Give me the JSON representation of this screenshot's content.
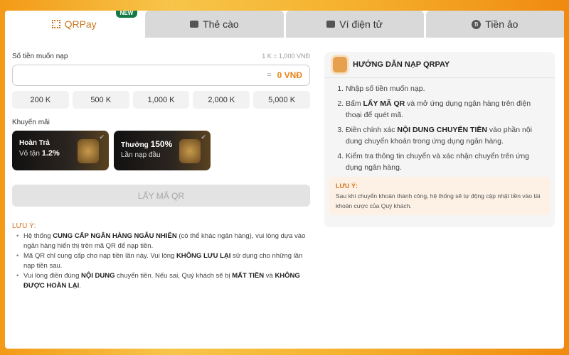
{
  "tabs": [
    {
      "label": "QRPay",
      "badge": "NEW"
    },
    {
      "label": "Thẻ cào"
    },
    {
      "label": "Ví điện tử"
    },
    {
      "label": "Tiền ảo"
    }
  ],
  "form": {
    "amount_label": "Số tiền muốn nạp",
    "rate": "1 K = 1,000 VNĐ",
    "equals": "=",
    "amount_value": "0 VNĐ",
    "chips": [
      "200 K",
      "500 K",
      "1,000 K",
      "2,000 K",
      "5,000 K"
    ]
  },
  "promos": {
    "label": "Khuyến mãi",
    "items": [
      {
        "title": "Hoàn Trả",
        "sub": "Vô tận",
        "highlight": "1.2%"
      },
      {
        "title": "Thưởng",
        "title_hl": "150%",
        "sub": "Lần nạp đầu"
      }
    ]
  },
  "get_qr": "LẤY MÃ QR",
  "notes": {
    "title": "LƯU Ý:",
    "items": [
      [
        "Hệ thống ",
        "CUNG CẤP NGÂN HÀNG NGẪU NHIÊN",
        " (có thể khác ngân hàng), vui lòng dựa vào ngân hàng hiển thị trên mã QR để nạp tiền."
      ],
      [
        "Mã QR chỉ cung cấp cho nạp tiền lần này. Vui lòng ",
        "KHÔNG LƯU LẠI",
        " sử dụng cho những lần nạp tiền sau."
      ],
      [
        "Vui lòng điền đúng ",
        "NỘI DUNG",
        " chuyển tiền. Nếu sai, Quý khách sẽ bị ",
        "MẤT TIỀN",
        " và ",
        "KHÔNG ĐƯỢC HOÀN LẠI",
        "."
      ]
    ]
  },
  "guide": {
    "title": "HƯỚNG DẪN NẠP QRPAY",
    "steps": [
      [
        "Nhập số tiền muốn nạp."
      ],
      [
        "Bấm ",
        "LẤY MÃ QR",
        " và mở ứng dụng ngân hàng trên điện thoại để quét mã."
      ],
      [
        "Điền chính xác ",
        "NỘI DUNG CHUYỂN TIỀN",
        " vào phần nội dung chuyển khoản trong ứng dụng ngân hàng."
      ],
      [
        "Kiểm tra thông tin chuyển và xác nhận chuyển trên ứng dụng ngân hàng."
      ]
    ],
    "tip_title": "LƯU Ý:",
    "tip": "Sau khi chuyển khoản thành công, hệ thống sẽ tự động cập nhật tiền vào tài khoản cược của Quý khách."
  }
}
